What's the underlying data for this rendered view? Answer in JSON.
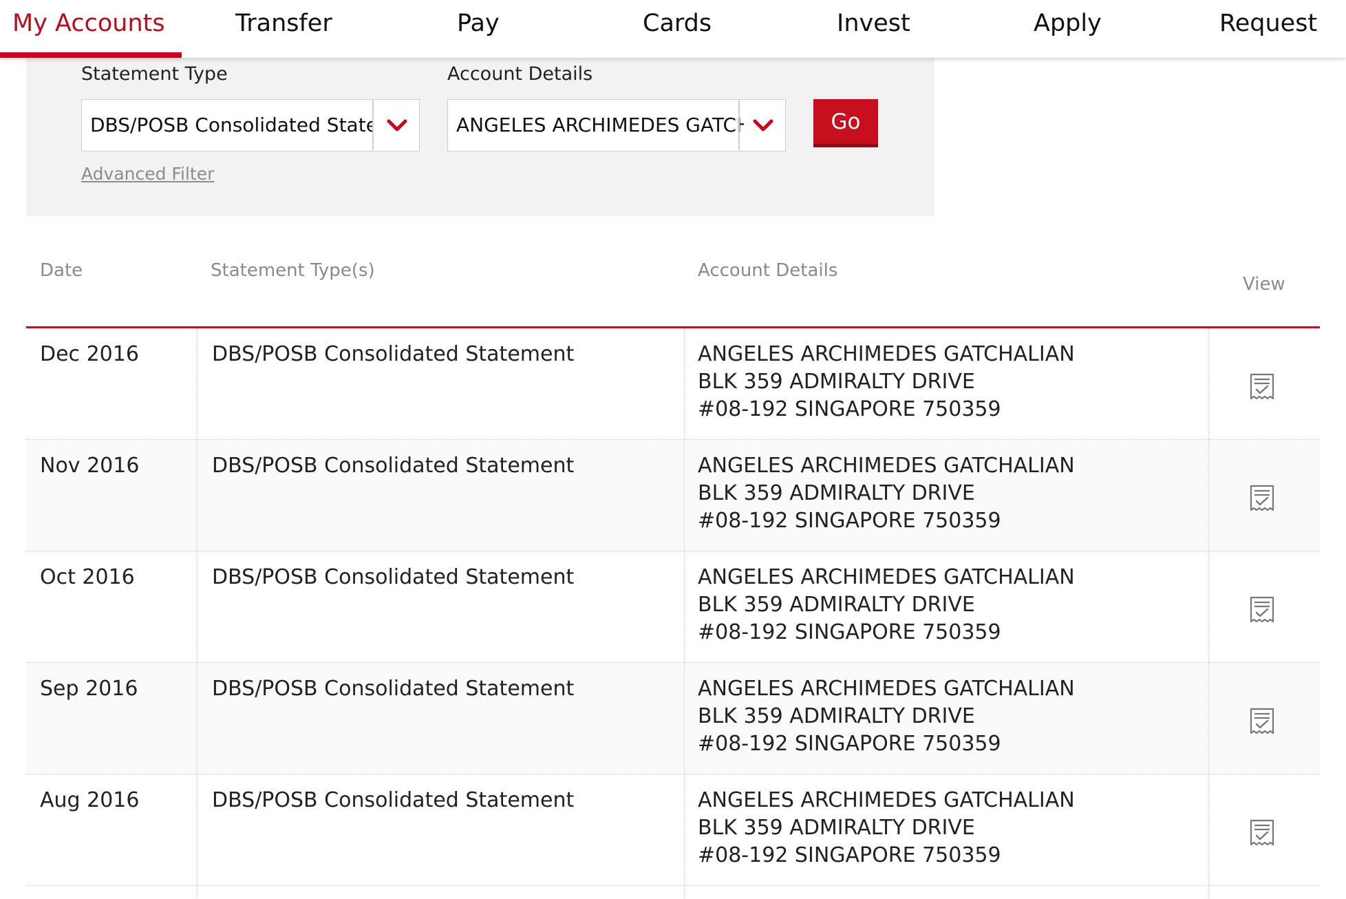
{
  "nav": {
    "items": [
      "My Accounts",
      "Transfer",
      "Pay",
      "Cards",
      "Invest",
      "Apply",
      "Request"
    ],
    "active_index": 0
  },
  "filters": {
    "statement_type_label": "Statement Type",
    "statement_type_value": "DBS/POSB Consolidated Statement",
    "account_details_label": "Account Details",
    "account_details_value": "ANGELES ARCHIMEDES GATCHALIAN",
    "go_label": "Go",
    "advanced_filter_label": "Advanced Filter"
  },
  "table": {
    "headers": {
      "date": "Date",
      "statement_types": "Statement Type(s)",
      "account_details": "Account Details",
      "view": "View"
    },
    "rows": [
      {
        "date": "Dec 2016",
        "statement_type": "DBS/POSB Consolidated Statement",
        "address_line1": "ANGELES ARCHIMEDES GATCHALIAN",
        "address_line2": "BLK 359 ADMIRALTY DRIVE",
        "address_line3": "#08-192 SINGAPORE 750359"
      },
      {
        "date": "Nov 2016",
        "statement_type": "DBS/POSB Consolidated Statement",
        "address_line1": "ANGELES ARCHIMEDES GATCHALIAN",
        "address_line2": "BLK 359 ADMIRALTY DRIVE",
        "address_line3": "#08-192 SINGAPORE 750359"
      },
      {
        "date": "Oct 2016",
        "statement_type": "DBS/POSB Consolidated Statement",
        "address_line1": "ANGELES ARCHIMEDES GATCHALIAN",
        "address_line2": "BLK 359 ADMIRALTY DRIVE",
        "address_line3": "#08-192 SINGAPORE 750359"
      },
      {
        "date": "Sep 2016",
        "statement_type": "DBS/POSB Consolidated Statement",
        "address_line1": "ANGELES ARCHIMEDES GATCHALIAN",
        "address_line2": "BLK 359 ADMIRALTY DRIVE",
        "address_line3": "#08-192 SINGAPORE 750359"
      },
      {
        "date": "Aug 2016",
        "statement_type": "DBS/POSB Consolidated Statement",
        "address_line1": "ANGELES ARCHIMEDES GATCHALIAN",
        "address_line2": "BLK 359 ADMIRALTY DRIVE",
        "address_line3": "#08-192 SINGAPORE 750359"
      }
    ]
  },
  "icons": {
    "chevron": "chevron-down-icon",
    "view": "statement-document-icon"
  },
  "colors": {
    "brand_red": "#c80f1e",
    "active_nav_text": "#b80d1b",
    "header_text": "#8a8a8a"
  }
}
